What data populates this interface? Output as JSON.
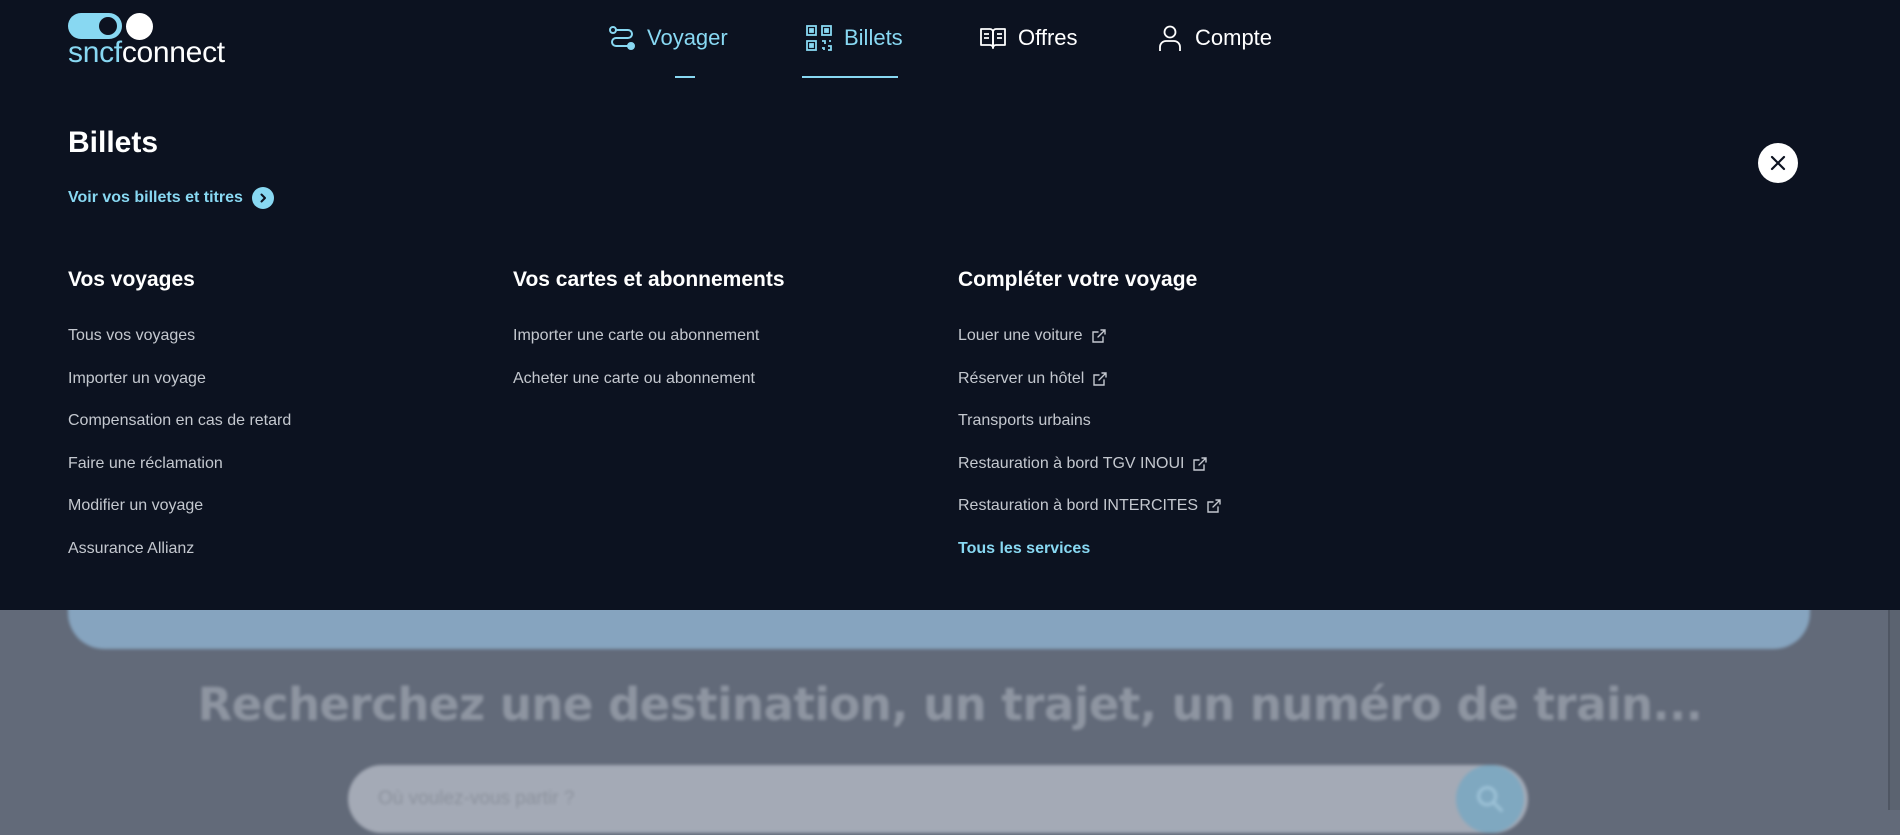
{
  "logo": {
    "part1": "sncf",
    "part2": "connect"
  },
  "nav": [
    {
      "label": "Voyager",
      "icon": "route-icon"
    },
    {
      "label": "Billets",
      "icon": "qr-code-icon"
    },
    {
      "label": "Offres",
      "icon": "book-icon"
    },
    {
      "label": "Compte",
      "icon": "user-icon"
    }
  ],
  "menu": {
    "title": "Billets",
    "see_tickets_link": "Voir vos billets et titres",
    "columns": [
      {
        "title": "Vos voyages",
        "items": [
          {
            "label": "Tous vos voyages"
          },
          {
            "label": "Importer un voyage"
          },
          {
            "label": "Compensation en cas de retard"
          },
          {
            "label": "Faire une réclamation"
          },
          {
            "label": "Modifier un voyage"
          },
          {
            "label": "Assurance Allianz"
          }
        ]
      },
      {
        "title": "Vos cartes et abonnements",
        "items": [
          {
            "label": "Importer une carte ou abonnement"
          },
          {
            "label": "Acheter une carte ou abonnement"
          }
        ]
      },
      {
        "title": "Compléter votre voyage",
        "items": [
          {
            "label": "Louer une voiture",
            "external": true
          },
          {
            "label": "Réserver un hôtel",
            "external": true
          },
          {
            "label": "Transports urbains"
          },
          {
            "label": "Restauration à bord TGV INOUI",
            "external": true
          },
          {
            "label": "Restauration à bord INTERCITES",
            "external": true
          },
          {
            "label": "Tous les services",
            "highlight": true
          }
        ]
      }
    ]
  },
  "background": {
    "headline": "Recherchez une destination, un trajet, un numéro de train...",
    "search_placeholder": "Où voulez-vous partir ?"
  },
  "colors": {
    "panel": "#0c1220",
    "accent": "#88d8f2",
    "text": "#ffffff",
    "link_muted": "#c4c8cf"
  }
}
